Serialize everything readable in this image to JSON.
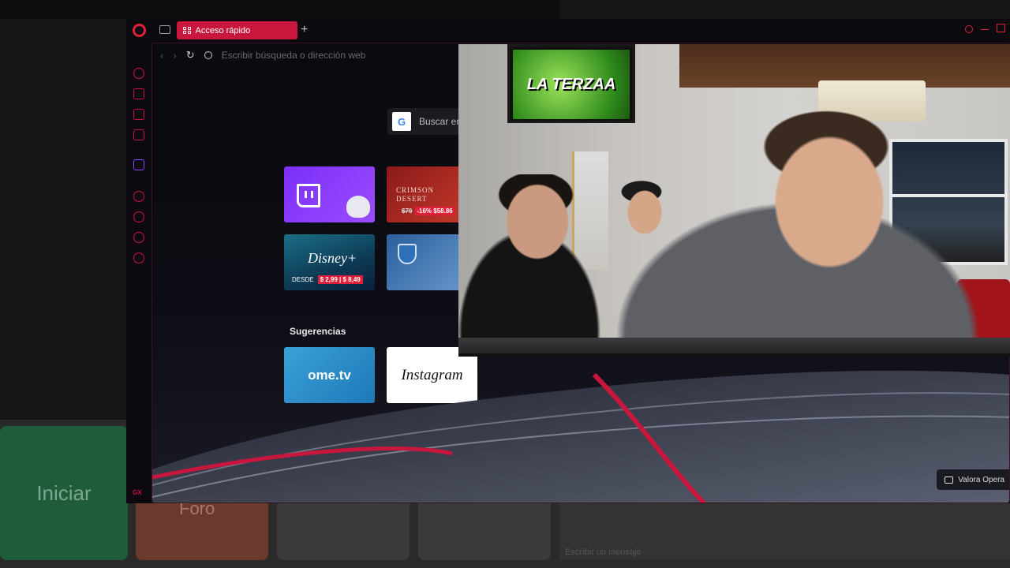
{
  "background_app": {
    "start_label": "Iniciar",
    "forum_label": "Foro",
    "chat_placeholder": "Escribir un mensaje"
  },
  "browser": {
    "active_tab_label": "Acceso rápido",
    "new_tab_symbol": "+",
    "address_placeholder": "Escribir búsqueda o dirección web",
    "search_placeholder": "Buscar en",
    "google_letter": "G",
    "speed_dials": [
      {
        "name": "Twitch"
      },
      {
        "name": "Crimson Desert",
        "title": "CRIMSON\nDESERT",
        "old_price": "$70",
        "price": "-16% $58.86"
      },
      {
        "name": "Disney+",
        "logo": "Disney+",
        "prefix": "DESDE",
        "price": "$ 2,99 | $ 8,49"
      },
      {
        "name": "World of Warships"
      }
    ],
    "suggestions_label": "Sugerencias",
    "suggestions": [
      {
        "name": "ome.tv",
        "label": "ome.tv"
      },
      {
        "name": "Instagram",
        "label": "Instagram"
      }
    ],
    "sidebar_gx_label": "GX",
    "sidebar_more_label": "•••",
    "rate_opera_label": "Valora Opera",
    "colors": {
      "accent": "#c8163d",
      "twitch": "#9146ff"
    }
  },
  "webcam": {
    "tv_text": "LA TERZAA"
  }
}
